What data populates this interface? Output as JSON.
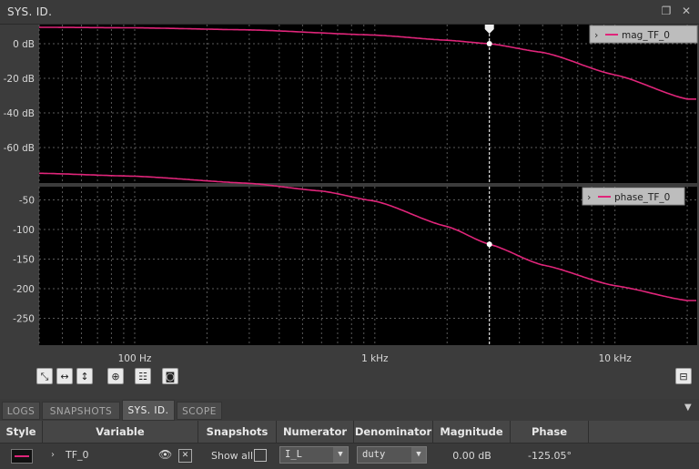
{
  "window": {
    "title": "SYS. ID."
  },
  "plot": {
    "magnitude": {
      "legend": "mag_TF_0",
      "y_ticks": [
        "0 dB",
        "-20 dB",
        "-40 dB",
        "-60 dB"
      ]
    },
    "phase": {
      "legend": "phase_TF_0",
      "y_ticks": [
        "-50",
        "-100",
        "-150",
        "-200",
        "-250"
      ]
    },
    "x_ticks": [
      "100 Hz",
      "1 kHz",
      "10 kHz"
    ],
    "trace_color": "#e0257a"
  },
  "chart_data": [
    {
      "type": "line",
      "xscale": "log",
      "x": [
        40,
        100,
        300,
        1000,
        2000,
        3000,
        5000,
        10000,
        20000
      ],
      "series": [
        {
          "name": "mag_TF_0",
          "values": [
            9.5,
            9.2,
            8,
            5,
            2,
            0,
            -5,
            -18,
            -32
          ]
        }
      ],
      "ylim": [
        -70,
        10
      ],
      "yticks": [
        "0 dB",
        "-20 dB",
        "-40 dB",
        "-60 dB"
      ],
      "xticks": [
        "100 Hz",
        "1 kHz",
        "10 kHz"
      ],
      "grid": true,
      "legend": "top-right",
      "cursor_x": 3000
    },
    {
      "type": "line",
      "xscale": "log",
      "x": [
        40,
        100,
        300,
        600,
        1000,
        2000,
        3000,
        5000,
        10000,
        20000
      ],
      "series": [
        {
          "name": "phase_TF_0",
          "values": [
            -5,
            -10,
            -22,
            -35,
            -52,
            -95,
            -125,
            -160,
            -195,
            -220
          ]
        }
      ],
      "ylim": [
        -260,
        0
      ],
      "yticks": [
        "-50",
        "-100",
        "-150",
        "-200",
        "-250"
      ],
      "xticks": [
        "100 Hz",
        "1 kHz",
        "10 kHz"
      ],
      "grid": true,
      "legend": "top-right",
      "cursor_x": 3000
    }
  ],
  "tabs": [
    "LOGS",
    "SNAPSHOTS",
    "SYS. ID.",
    "SCOPE"
  ],
  "active_tab": "SYS. ID.",
  "table": {
    "headers": [
      "Style",
      "Variable",
      "Snapshots",
      "Numerator",
      "Denominator",
      "Magnitude",
      "Phase"
    ],
    "row": {
      "variable": "TF_0",
      "snapshots": "Show all",
      "numerator": "I_L",
      "denominator": "duty",
      "magnitude": "0.00 dB",
      "phase": "-125.05°"
    }
  }
}
